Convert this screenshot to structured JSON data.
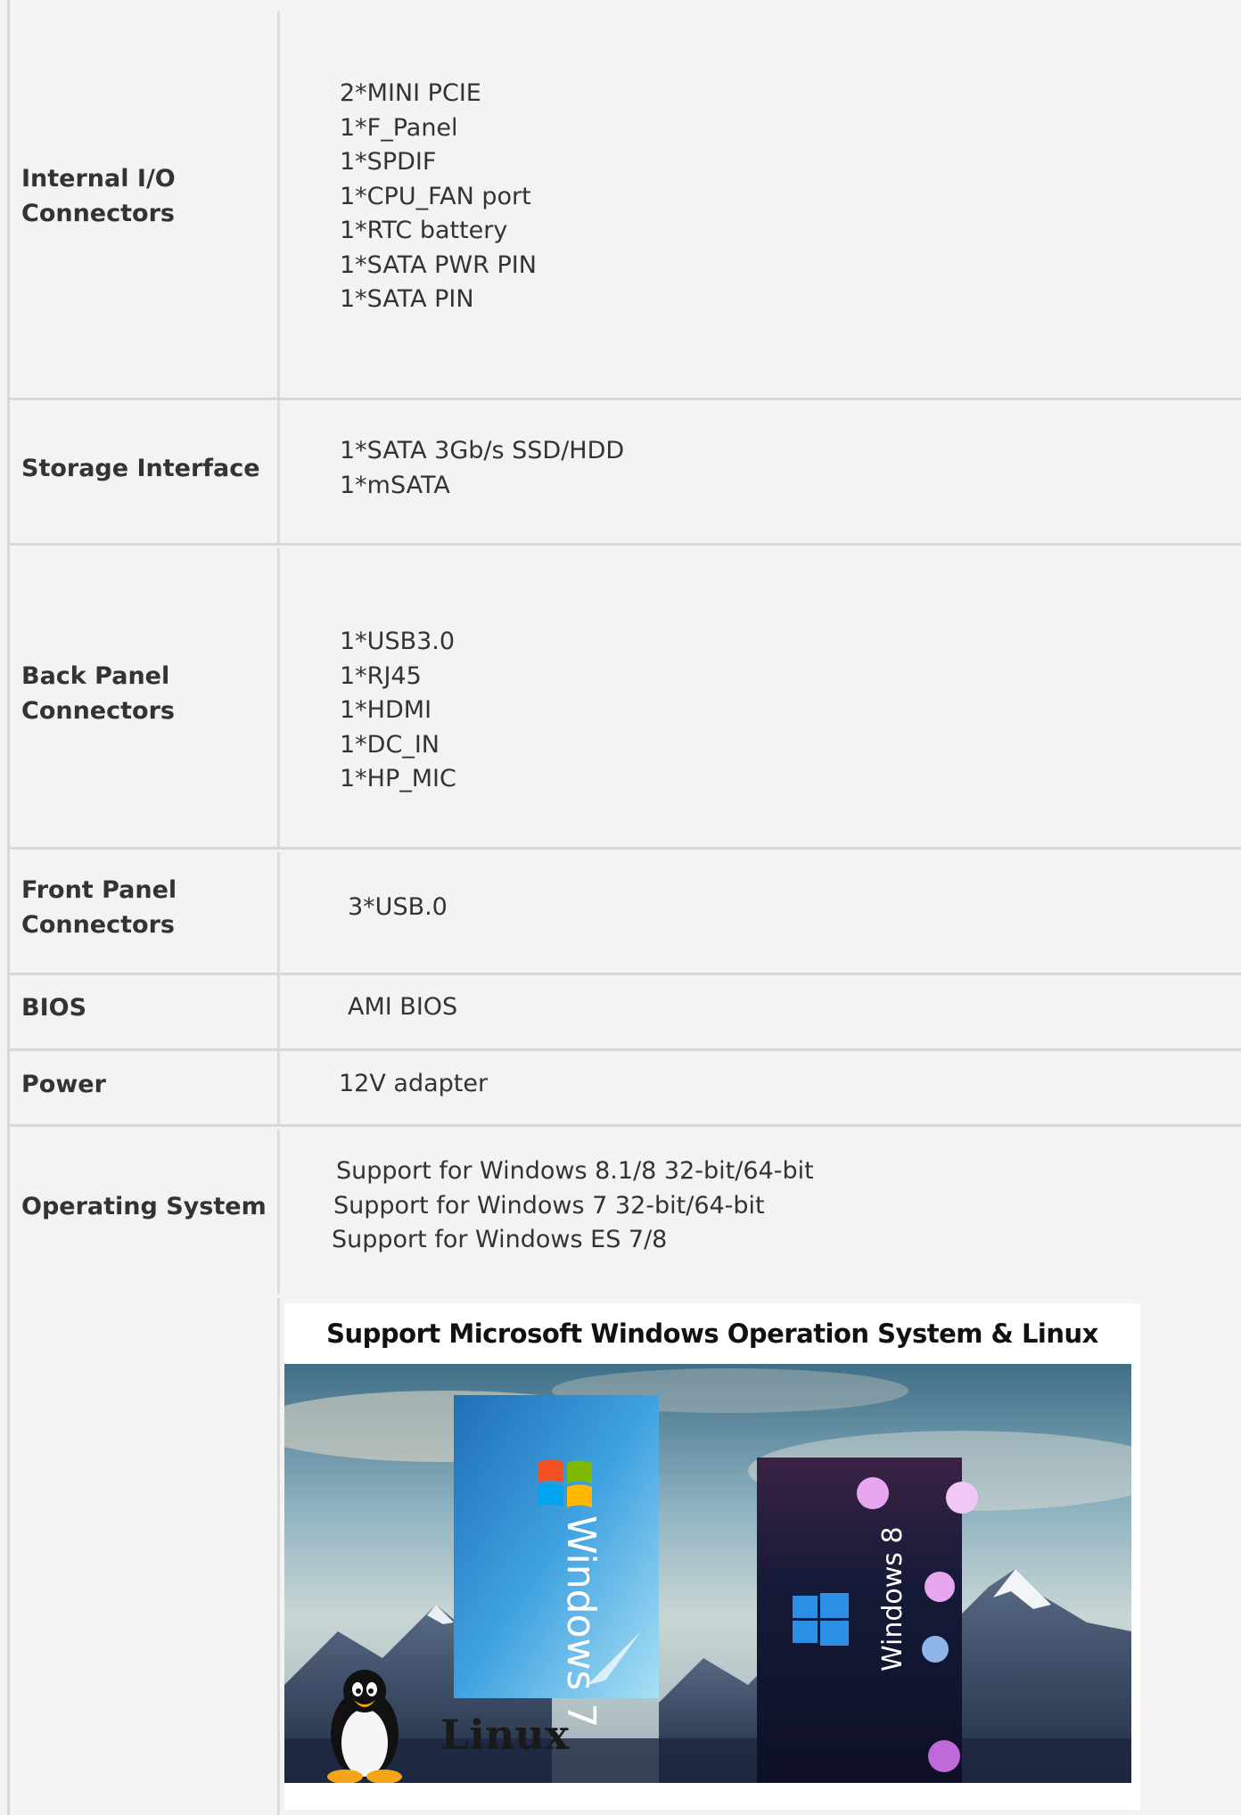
{
  "rows": {
    "internal_io": {
      "label": "Internal I/O Connectors",
      "values": [
        "2*MINI PCIE",
        "1*F_Panel",
        "1*SPDIF",
        "1*CPU_FAN port",
        "1*RTC battery",
        "1*SATA PWR PIN",
        "1*SATA PIN"
      ]
    },
    "storage": {
      "label": "Storage Interface",
      "values": [
        "1*SATA 3Gb/s SSD/HDD",
        "1*mSATA"
      ]
    },
    "back_panel": {
      "label": "Back Panel Connectors",
      "values": [
        "1*USB3.0",
        "1*RJ45",
        "1*HDMI",
        "1*DC_IN",
        "1*HP_MIC"
      ]
    },
    "front_panel": {
      "label": "Front Panel Connectors",
      "values": [
        "3*USB.0"
      ]
    },
    "bios": {
      "label": "BIOS",
      "values": [
        "AMI BIOS"
      ]
    },
    "power": {
      "label": "Power",
      "values": [
        "12V adapter"
      ]
    },
    "os": {
      "label": "Operating System",
      "values": [
        "Support for Windows 8.1/8 32-bit/64-bit",
        "Support for Windows 7 32-bit/64-bit",
        "Support for Windows ES 7/8"
      ]
    }
  },
  "os_image": {
    "title": "Support Microsoft Windows Operation System & Linux",
    "windows7_label": "Windows 7",
    "windows8_label": "Windows 8",
    "linux_label": "Linux",
    "colors": {
      "sky_top": "#3f6f88",
      "sky_mid": "#a9c3cb",
      "mountain": "#2e3e58",
      "win7_box": "#2f8fd2",
      "win8_box": "#1a1830",
      "win8_accent": "#e7a6f0"
    }
  }
}
